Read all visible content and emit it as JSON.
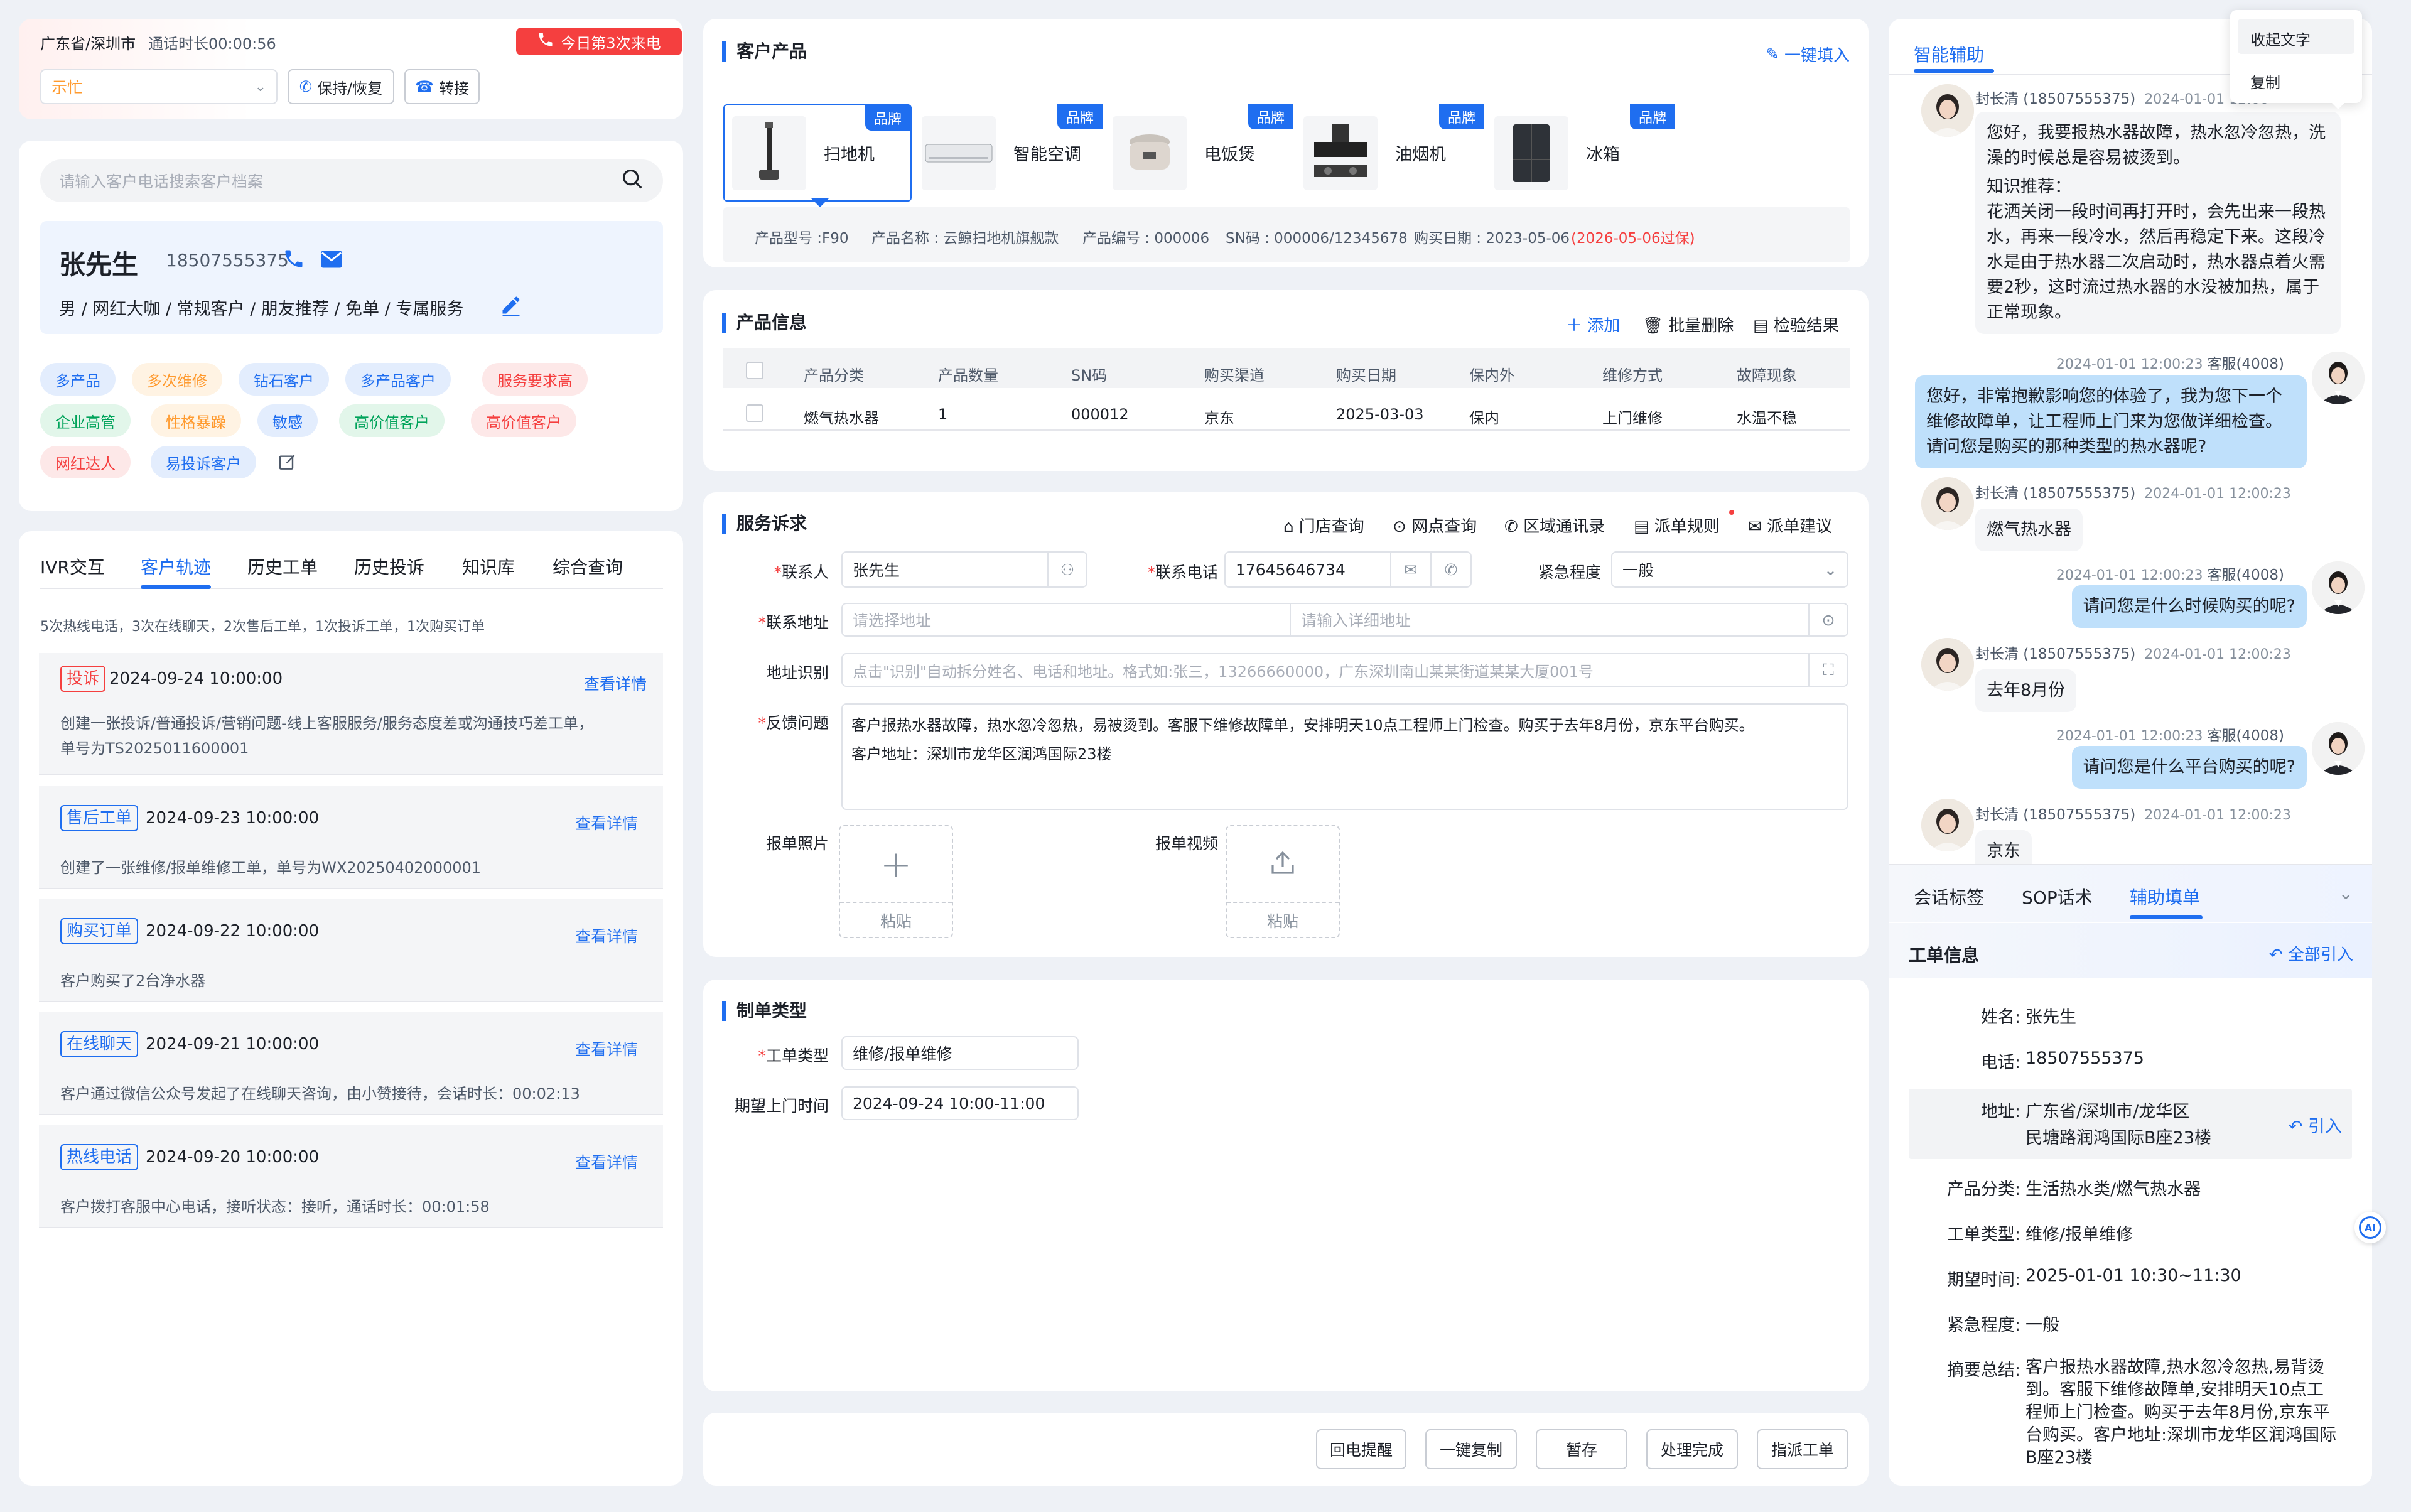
{
  "call_bar": {
    "location": "广东省/深圳市",
    "duration": "通话时长00:00:56",
    "call_badge": "今日第3次来电",
    "status_select": "示忙",
    "hold_label": "保持/恢复",
    "transfer_label": "转接"
  },
  "customer": {
    "search_placeholder": "请输入客户电话搜索客户档案",
    "name": "张先生",
    "phone": "18507555375",
    "profile": "男 / 网红大咖 / 常规客户 / 朋友推荐 / 免单 / 专属服务",
    "tags": [
      {
        "label": "多产品",
        "color": "#1f6ef0",
        "bg": "#e3edfd"
      },
      {
        "label": "多次维修",
        "color": "#ff9a2e",
        "bg": "#fff3e3"
      },
      {
        "label": "钻石客户",
        "color": "#1f6ef0",
        "bg": "#e3edfd"
      },
      {
        "label": "多产品客户",
        "color": "#1f6ef0",
        "bg": "#e3edfd"
      },
      {
        "label": "服务要求高",
        "color": "#f53f3f",
        "bg": "#fde8e8"
      },
      {
        "label": "企业高管",
        "color": "#00a35a",
        "bg": "#e2f6ea"
      },
      {
        "label": "性格暴躁",
        "color": "#ff9a2e",
        "bg": "#fff3e3"
      },
      {
        "label": "敏感",
        "color": "#1f6ef0",
        "bg": "#e3edfd"
      },
      {
        "label": "高价值客户",
        "color": "#00a35a",
        "bg": "#e2f6ea"
      },
      {
        "label": "高价值客户",
        "color": "#f53f3f",
        "bg": "#fde8e8"
      },
      {
        "label": "网红达人",
        "color": "#f53f3f",
        "bg": "#fde8e8"
      },
      {
        "label": "易投诉客户",
        "color": "#1f6ef0",
        "bg": "#e3edfd"
      }
    ]
  },
  "left_tabs": [
    "IVR交互",
    "客户轨迹",
    "历史工单",
    "历史投诉",
    "知识库",
    "综合查询"
  ],
  "track": {
    "summary": "5次热线电话，3次在线聊天，2次售后工单，1次投诉工单，1次购买订单",
    "view_label": "查看详情",
    "items": [
      {
        "type": "投诉",
        "color": "#f53f3f",
        "time": "2024-09-24 10:00:00",
        "desc1": "创建一张投诉/普通投诉/营销问题-线上客服服务/服务态度差或沟通技巧差工单，",
        "desc2": "单号为TS2025011600001"
      },
      {
        "type": "售后工单",
        "color": "#1f6ef0",
        "time": "2024-09-23 10:00:00",
        "desc1": "创建了一张维修/报单维修工单，单号为WX20250402000001",
        "desc2": ""
      },
      {
        "type": "购买订单",
        "color": "#1f6ef0",
        "time": "2024-09-22 10:00:00",
        "desc1": "客户购买了2台净水器",
        "desc2": ""
      },
      {
        "type": "在线聊天",
        "color": "#1f6ef0",
        "time": "2024-09-21 10:00:00",
        "desc1": "客户通过微信公众号发起了在线聊天咨询，由小赞接待，会话时长：00:02:13",
        "desc2": ""
      },
      {
        "type": "热线电话",
        "color": "#1f6ef0",
        "time": "2024-09-20 10:00:00",
        "desc1": "客户拨打客服中心电话，接听状态：接听，通话时长：00:01:58",
        "desc2": ""
      }
    ]
  },
  "products": {
    "title": "客户产品",
    "fill_label": "一键填入",
    "brand_label": "品牌",
    "items": [
      "扫地机",
      "智能空调",
      "电饭煲",
      "油烟机",
      "冰箱"
    ],
    "detail": {
      "model": "产品型号 :F90",
      "name": "产品名称 : 云鲸扫地机旗舰款",
      "number": "产品编号 : 000006",
      "sn": "SN码 : 000006/12345678",
      "date": "购买日期 : 2023-05-06",
      "warranty": "(2026-05-06过保)"
    }
  },
  "product_info": {
    "title": "产品信息",
    "add": "添加",
    "batch_delete": "批量删除",
    "check_result": "检验结果",
    "headers": [
      "产品分类",
      "产品数量",
      "SN码",
      "购买渠道",
      "购买日期",
      "保内外",
      "维修方式",
      "故障现象"
    ],
    "row": [
      "燃气热水器",
      "1",
      "000012",
      "京东",
      "2025-03-03",
      "保内",
      "上门维修",
      "水温不稳"
    ]
  },
  "service": {
    "title": "服务诉求",
    "tools": [
      "门店查询",
      "网点查询",
      "区域通讯录",
      "派单规则",
      "派单建议"
    ],
    "contact_label": "联系人",
    "contact_value": "张先生",
    "phone_label": "联系电话",
    "phone_value": "17645646734",
    "urgency_label": "紧急程度",
    "urgency_value": "一般",
    "address_label": "联系地址",
    "address_ph1": "请选择地址",
    "address_ph2": "请输入详细地址",
    "recog_label": "地址识别",
    "recog_ph": "点击\"识别\"自动拆分姓名、电话和地址。格式如:张三，13266660000，广东深圳南山某某街道某某大厦001号",
    "feedback_label": "反馈问题",
    "feedback_line1": "客户报热水器故障，热水忽冷忽热，易被烫到。客服下维修故障单，安排明天10点工程师上门检查。购买于去年8月份，京东平台购买。",
    "feedback_line2": "客户地址：深圳市龙华区润鸿国际23楼",
    "photo_label": "报单照片",
    "video_label": "报单视频",
    "paste": "粘贴"
  },
  "order_type": {
    "title": "制单类型",
    "type_label": "工单类型",
    "type_value": "维修/报单维修",
    "time_label": "期望上门时间",
    "time_value": "2024-09-24 10:00-11:00"
  },
  "actions": [
    "回电提醒",
    "一键复制",
    "暂存",
    "处理完成",
    "指派工单"
  ],
  "assist": {
    "title": "智能辅助",
    "menu": [
      "收起文字",
      "复制"
    ],
    "customer_meta": "封长清 (18507555375)",
    "agent_meta": "客服(4008)",
    "msg_time": "2024-01-01 12:00:23",
    "first_time": "2024-01-01 12:00",
    "msg1": "您好，我要报热水器故障，热水忽冷忽热，洗澡的时候总是容易被烫到。",
    "knowledge_title": "知识推荐：",
    "knowledge": "花洒关闭一段时间再打开时，会先出来一段热水，再来一段冷水，然后再稳定下来。这段冷水是由于热水器二次启动时，热水器点着火需要2秒，这时流过热水器的水没被加热，属于正常现象。",
    "msg2": "您好，非常抱歉影响您的体验了，我为您下一个维修故障单，让工程师上门来为您做详细检查。请问您是购买的那种类型的热水器呢?",
    "msg3": "燃气热水器",
    "msg4": "请问您是什么时候购买的呢?",
    "msg5": "去年8月份",
    "msg6": "请问您是什么平台购买的呢?",
    "msg7": "京东",
    "tabs": [
      "会话标签",
      "SOP话术",
      "辅助填单"
    ],
    "form_title": "工单信息",
    "import_all": "全部引入",
    "import": "引入",
    "ai_label": "AI",
    "fields": [
      {
        "k": "姓名:",
        "v": "张先生"
      },
      {
        "k": "电话:",
        "v": "18507555375"
      },
      {
        "k": "地址:",
        "v": "广东省/深圳市/龙华区",
        "v2": "民塘路润鸿国际B座23楼"
      },
      {
        "k": "产品分类:",
        "v": "生活热水类/燃气热水器"
      },
      {
        "k": "工单类型:",
        "v": "维修/报单维修"
      },
      {
        "k": "期望时间:",
        "v": "2025-01-01 10:30~11:30"
      },
      {
        "k": "紧急程度:",
        "v": "一般"
      },
      {
        "k": "摘要总结:",
        "v": "客户报热水器故障,热水忽冷忽热,易背烫到。客服下维修故障单,安排明天10点工程师上门检查。购买于去年8月份,京东平台购买。客户地址:深圳市龙华区润鸿国际B座23楼"
      }
    ]
  }
}
